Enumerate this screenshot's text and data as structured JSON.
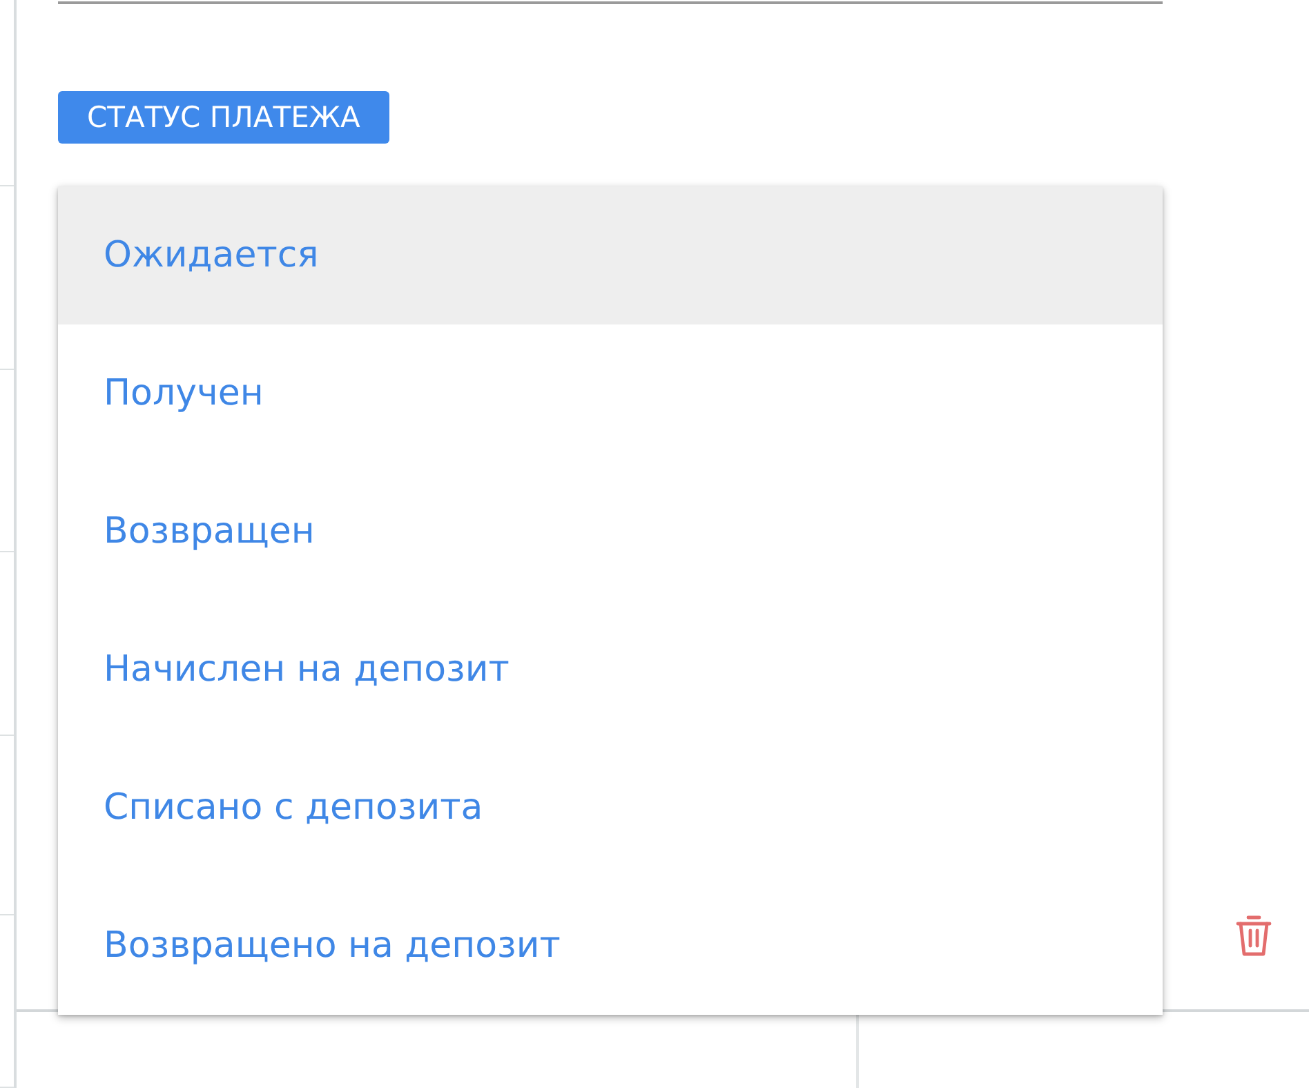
{
  "status_label": "СТАТУС ПЛАТЕЖА",
  "status_menu": {
    "options": [
      {
        "label": "Ожидается",
        "selected": true
      },
      {
        "label": "Получен",
        "selected": false
      },
      {
        "label": "Возвращен",
        "selected": false
      },
      {
        "label": "Начислен на депозит",
        "selected": false
      },
      {
        "label": "Списано с депозита",
        "selected": false
      },
      {
        "label": "Возвращено на депозит",
        "selected": false
      }
    ]
  }
}
